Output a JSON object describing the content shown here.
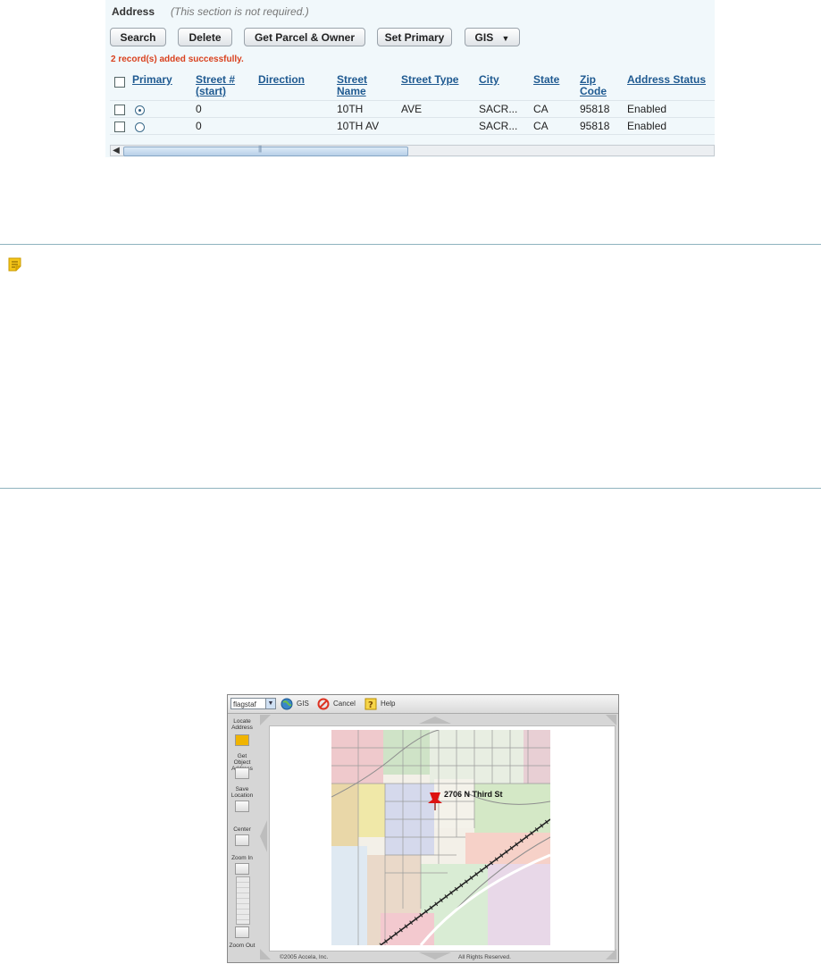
{
  "address_section": {
    "title": "Address",
    "note": "(This section is not required.)",
    "buttons": {
      "search": "Search",
      "delete": "Delete",
      "get_parcel_owner": "Get Parcel & Owner",
      "set_primary": "Set Primary",
      "gis": "GIS"
    },
    "success_message": "2 record(s) added successfully.",
    "columns": {
      "primary": "Primary",
      "street_no_1": "Street #",
      "street_no_2": "(start)",
      "direction": "Direction",
      "street_name_1": "Street",
      "street_name_2": "Name",
      "street_type": "Street Type",
      "city": "City",
      "state": "State",
      "zip_1": "Zip",
      "zip_2": "Code",
      "address_status": "Address Status"
    },
    "rows": [
      {
        "primary_selected": true,
        "street_no": "0",
        "direction": "",
        "street_name": "10TH",
        "street_type": "AVE",
        "city": "SACR...",
        "state": "CA",
        "zip": "95818",
        "status": "Enabled"
      },
      {
        "primary_selected": false,
        "street_no": "0",
        "direction": "",
        "street_name": "10TH AV",
        "street_type": "",
        "city": "SACR...",
        "state": "CA",
        "zip": "95818",
        "status": "Enabled"
      }
    ]
  },
  "map_viewer": {
    "layer_select": "flagstaf",
    "toolbar": {
      "gis": "GIS",
      "cancel": "Cancel",
      "help": "Help"
    },
    "side_tools": {
      "locate_1": "Locate",
      "locate_2": "Address",
      "getobj_1": "Get Object",
      "getobj_2": "Address",
      "save_1": "Save",
      "save_2": "Location",
      "center": "Center",
      "zoom_in": "Zoom In",
      "zoom_out": "Zoom Out"
    },
    "pin_label": "2706 N Third St",
    "footer_left": "©2005 Accela, Inc.",
    "footer_right": "All Rights Reserved."
  },
  "colors": {
    "link": "#1f5a91",
    "success": "#d9411e",
    "panel": "#f1f8fb",
    "divider": "#8fb3bf"
  }
}
